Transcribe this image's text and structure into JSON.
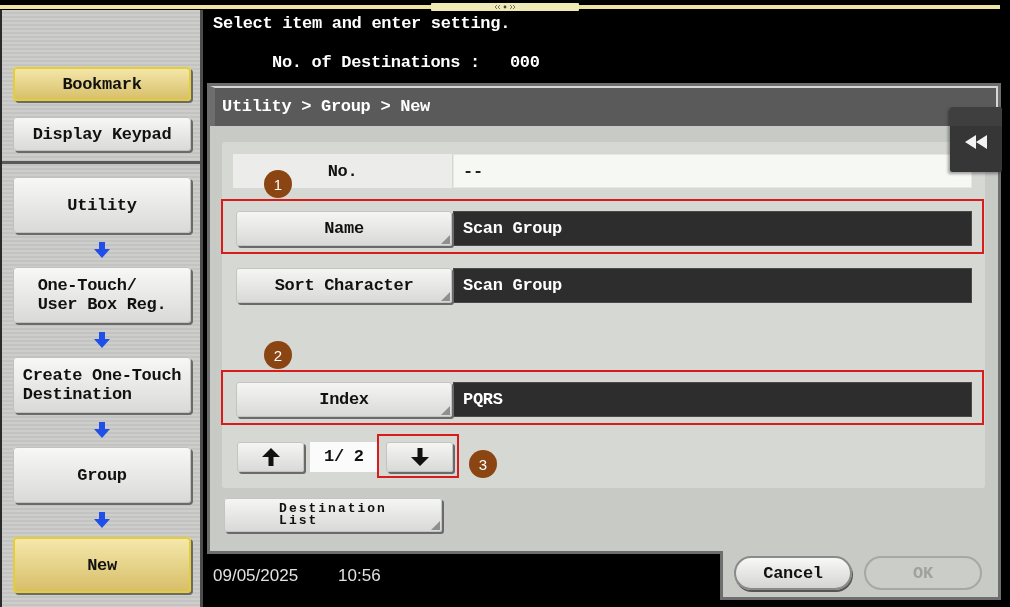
{
  "sidebar": {
    "top_buttons": [
      {
        "label": "Bookmark",
        "selected": true
      },
      {
        "label": "Display Keypad",
        "selected": false
      }
    ],
    "path": [
      {
        "label": "Utility",
        "selected": false
      },
      {
        "label": "One-Touch/\nUser Box Reg.",
        "selected": false
      },
      {
        "label": "Create One-Touch\nDestination",
        "selected": false
      },
      {
        "label": "Group",
        "selected": false
      },
      {
        "label": "New",
        "selected": true
      }
    ]
  },
  "message": "Select item and enter setting.",
  "destinations": {
    "label": "No. of Destinations :",
    "value": "000"
  },
  "panel": {
    "breadcrumb": "Utility > Group > New",
    "fields": [
      {
        "kind": "readonly",
        "label": "No.",
        "value": "--",
        "highlighted": false
      },
      {
        "kind": "button",
        "label": "Name",
        "value": "Scan Group",
        "highlighted": true,
        "marker": "1"
      },
      {
        "kind": "button",
        "label": "Sort Character",
        "value": "Scan Group",
        "highlighted": false
      },
      {
        "kind": "button",
        "label": "Index",
        "value": "PQRS",
        "highlighted": true,
        "marker": "2"
      }
    ],
    "pager": {
      "buttons": [
        {
          "kind": "up",
          "highlighted": false
        },
        {
          "kind": "down",
          "highlighted": true,
          "marker": "3"
        }
      ],
      "page": "1/ 2"
    },
    "destination_list_button": "Destination\nList"
  },
  "footer": {
    "date": "09/05/2025",
    "time": "10:56"
  },
  "actions": [
    {
      "label": "Cancel",
      "disabled": false
    },
    {
      "label": "OK",
      "disabled": true
    }
  ]
}
